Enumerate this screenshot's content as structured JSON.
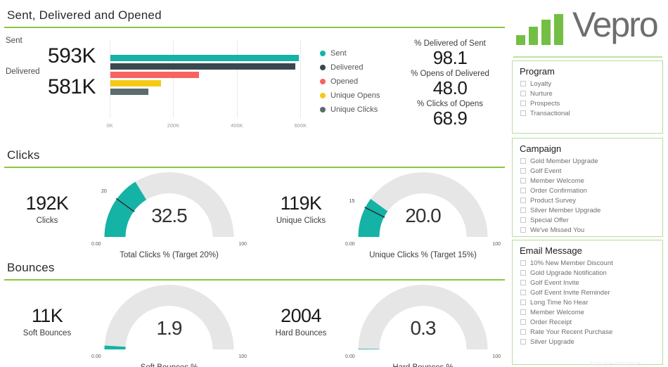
{
  "colors": {
    "teal": "#14B3A6",
    "dark": "#39474F",
    "red": "#F9635F",
    "yellow": "#F4CA18",
    "gray": "#5B6B6E",
    "green_rule": "#8DC63F",
    "panel_border": "#b7dd9e",
    "gauge_track": "#E6E6E6",
    "logo_green": "#72BF44",
    "logo_text": "#6d6e6e"
  },
  "sections": {
    "sent": {
      "title": "Sent, Delivered and Opened"
    },
    "clicks": {
      "title": "Clicks"
    },
    "bounces": {
      "title": "Bounces"
    }
  },
  "kpis": {
    "sent_label": "Sent",
    "sent_value": "593K",
    "delivered_label": "Delivered",
    "delivered_value": "581K"
  },
  "percents": [
    {
      "label": "% Delivered of Sent",
      "value": "98.1"
    },
    {
      "label": "% Opens of Delivered",
      "value": "48.0"
    },
    {
      "label": "% Clicks of Opens",
      "value": "68.9"
    }
  ],
  "chart_data": {
    "type": "bar",
    "orientation": "horizontal",
    "title": "Sent, Delivered and Opened",
    "xlabel": "",
    "ylabel": "",
    "xlim": [
      0,
      650000
    ],
    "grid": true,
    "tick_labels": [
      "0K",
      "200K",
      "400K",
      "600K"
    ],
    "tick_values": [
      0,
      200000,
      400000,
      600000
    ],
    "legend_position": "right",
    "categories": [
      "Sent",
      "Delivered",
      "Opened",
      "Unique Opens",
      "Unique Clicks"
    ],
    "values": [
      593000,
      581000,
      279000,
      160000,
      119000
    ],
    "colors": [
      "#14B3A6",
      "#39474F",
      "#F9635F",
      "#F4CA18",
      "#5B6B6E"
    ]
  },
  "legend": [
    {
      "label": "Sent",
      "color": "#14B3A6"
    },
    {
      "label": "Delivered",
      "color": "#39474F"
    },
    {
      "label": "Opened",
      "color": "#F9635F"
    },
    {
      "label": "Unique Opens",
      "color": "#F4CA18"
    },
    {
      "label": "Unique Clicks",
      "color": "#5B6B6E"
    }
  ],
  "gauges": [
    {
      "kpi_value": "192K",
      "kpi_label": "Clicks",
      "value": "32.5",
      "value_num": 32.5,
      "min": "0.00",
      "max": "100",
      "min_num": 0,
      "max_num": 100,
      "target": "20",
      "target_num": 20,
      "caption": "Total Clicks % (Target 20%)"
    },
    {
      "kpi_value": "119K",
      "kpi_label": "Unique Clicks",
      "value": "20.0",
      "value_num": 20.0,
      "min": "0.00",
      "max": "100",
      "min_num": 0,
      "max_num": 100,
      "target": "15",
      "target_num": 15,
      "caption": "Unique Clicks % (Target 15%)"
    },
    {
      "kpi_value": "11K",
      "kpi_label": "Soft Bounces",
      "value": "1.9",
      "value_num": 1.9,
      "min": "0.00",
      "max": "100",
      "min_num": 0,
      "max_num": 100,
      "target": null,
      "target_num": null,
      "caption": "Soft Bounces %"
    },
    {
      "kpi_value": "2004",
      "kpi_label": "Hard Bounces",
      "value": "0.3",
      "value_num": 0.3,
      "min": "0.00",
      "max": "100",
      "min_num": 0,
      "max_num": 100,
      "target": null,
      "target_num": null,
      "caption": "Hard Bounces %"
    }
  ],
  "logo": {
    "text": "Vepro"
  },
  "filters": [
    {
      "title": "Program",
      "items": [
        "Loyalty",
        "Nurture",
        "Prospects",
        "Transactional"
      ]
    },
    {
      "title": "Campaign",
      "items": [
        "Gold Member Upgrade",
        "Golf Event",
        "Member Welcome",
        "Order Confirmation",
        "Product Survey",
        "Silver Member Upgrade",
        "Special Offer",
        "We've Missed You"
      ]
    },
    {
      "title": "Email Message",
      "items": [
        "10% New Member Discount",
        "Gold Upgrade Notification",
        "Golf Event Invite",
        "Golf Event Invite Reminder",
        "Long Time No Hear",
        "Member Welcome",
        "Order Receipt",
        "Rate Your Recent Purchase",
        "Silver Upgrade"
      ]
    }
  ],
  "watermark": "Activate Windows"
}
